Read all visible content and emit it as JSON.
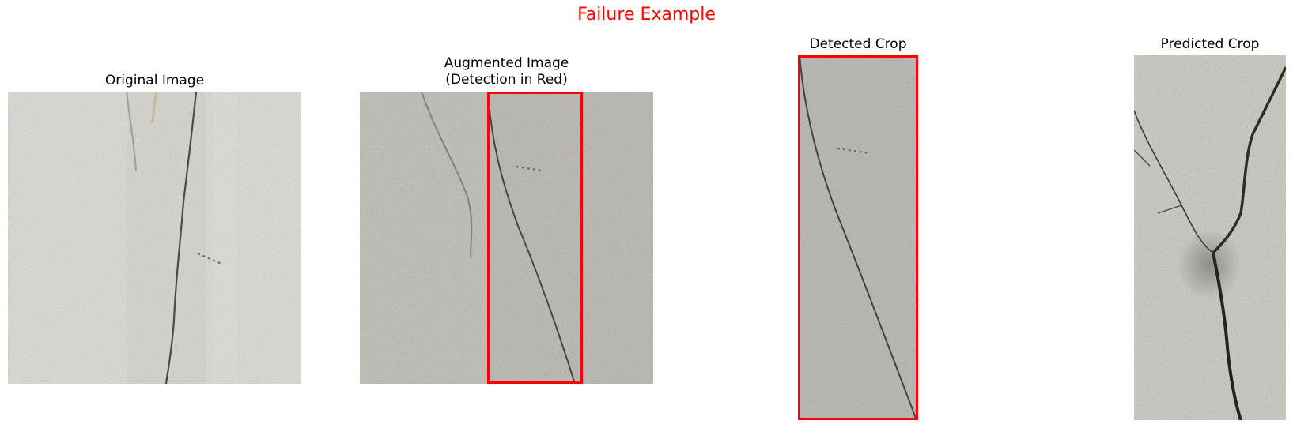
{
  "figure": {
    "title": "Failure Example",
    "title_color": "#ff0000"
  },
  "panels": [
    {
      "title_lines": [
        "Original Image"
      ],
      "subject": "concrete wall with vertical crack"
    },
    {
      "title_lines": [
        "Augmented Image",
        "(Detection in Red)"
      ],
      "subject": "augmented concrete wall with detection box"
    },
    {
      "title_lines": [
        "Detected Crop"
      ],
      "subject": "cropped detection region of crack"
    },
    {
      "title_lines": [
        "Predicted Crop"
      ],
      "subject": "concrete surface with branching crack"
    }
  ],
  "detection_box_color": "#ff0000"
}
